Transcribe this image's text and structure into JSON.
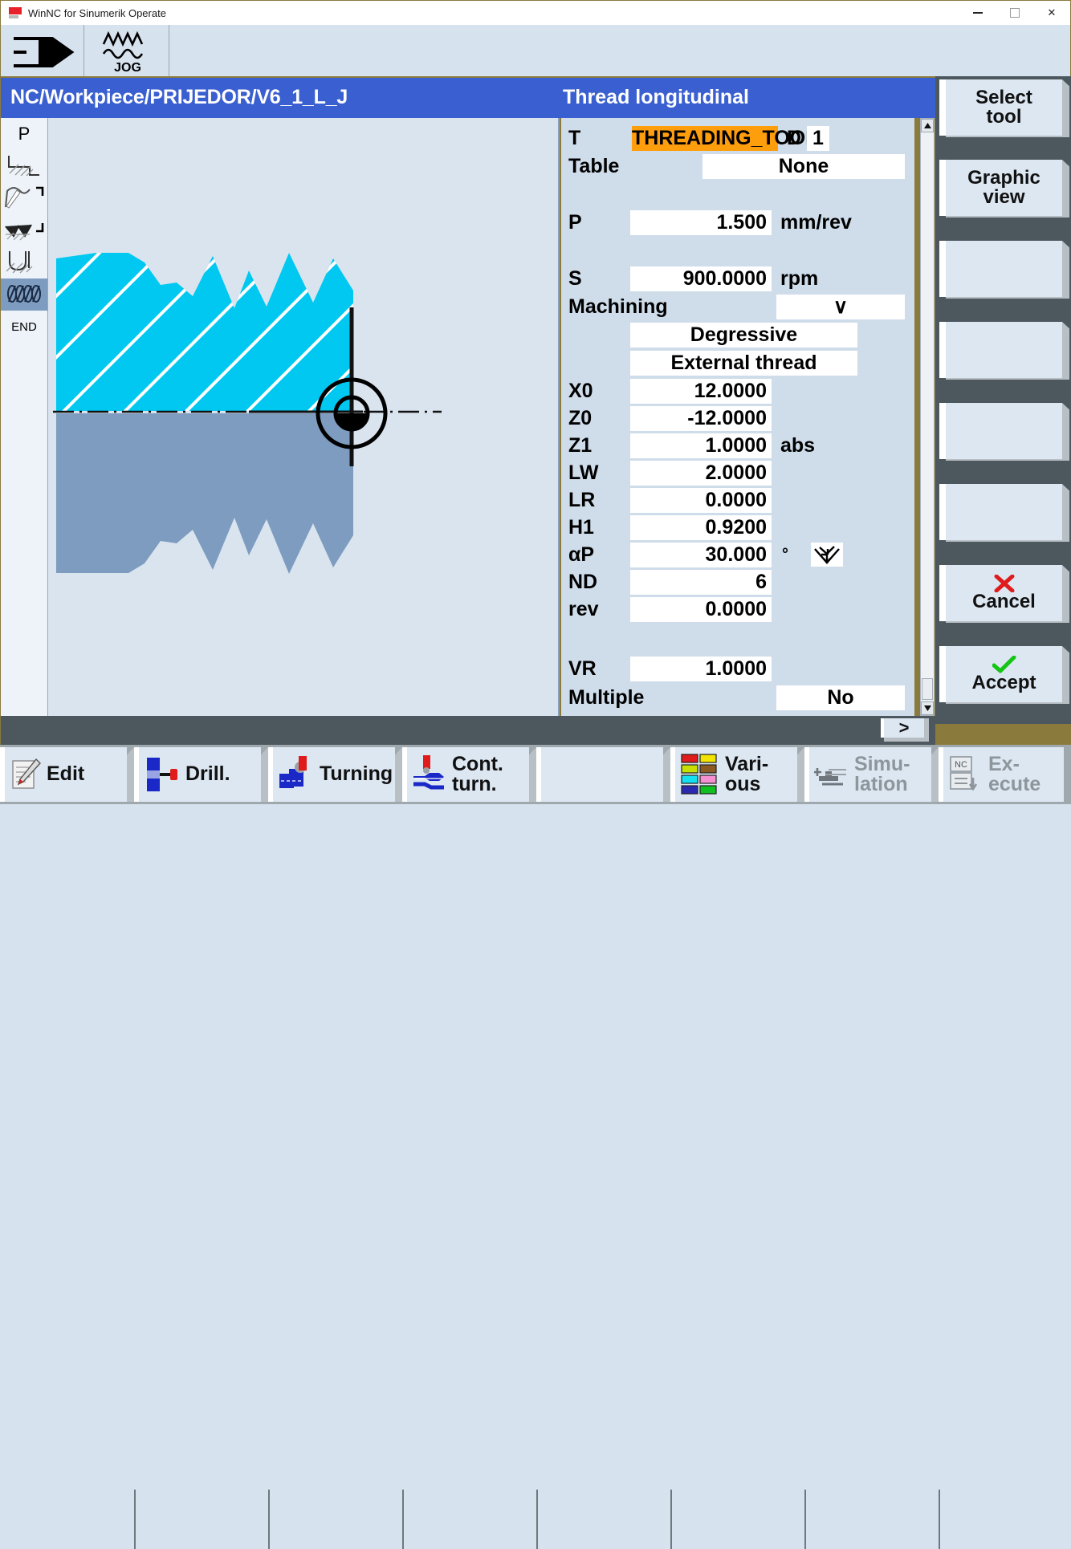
{
  "window": {
    "title": "WinNC for Sinumerik Operate",
    "controls": {
      "minimize": "minimize-icon",
      "maximize": "maximize-icon",
      "close": "close-icon"
    }
  },
  "toolbar": {
    "mode_icon": "machine-arrow-icon",
    "jog_label": "JOG",
    "jog_icon": "jog-wave-icon"
  },
  "header": {
    "path": "NC/Workpiece/PRIJEDOR/V6_1_L_J",
    "dialog_title": "Thread longitudinal",
    "accent": "#3a5fd0"
  },
  "steps": {
    "top_label": "P",
    "end_label": "END",
    "items": [
      {
        "name": "blank-stock-icon",
        "selected": false
      },
      {
        "name": "contour-turning-icon",
        "selected": false
      },
      {
        "name": "groove-icon",
        "selected": false
      },
      {
        "name": "undercut-icon",
        "selected": false
      },
      {
        "name": "thread-icon",
        "selected": true
      }
    ]
  },
  "graphic": {
    "name": "thread-longitudinal-help-graphic",
    "thread_color": "#00c8f0",
    "body_color": "#7e9cc0",
    "background": "#d9e4ef"
  },
  "form": {
    "tool": {
      "label": "T",
      "value": "THREADING_TOOL",
      "highlight": "#ff9e0d",
      "d_label": "D",
      "d_value": "1"
    },
    "table": {
      "label": "Table",
      "value": "None"
    },
    "pitch": {
      "label": "P",
      "value": "1.500",
      "unit": "mm/rev"
    },
    "spindle": {
      "label": "S",
      "value": "900.0000",
      "unit": "rpm"
    },
    "machining": {
      "label": "Machining",
      "value": "∨"
    },
    "infeed_mode": {
      "value": "Degressive"
    },
    "thread_type": {
      "value": "External thread"
    },
    "rows": [
      {
        "label": "X0",
        "value": "12.0000",
        "unit": ""
      },
      {
        "label": "Z0",
        "value": "-12.0000",
        "unit": ""
      },
      {
        "label": "Z1",
        "value": "1.0000",
        "unit": "abs"
      },
      {
        "label": "LW",
        "value": "2.0000",
        "unit": ""
      },
      {
        "label": "LR",
        "value": "0.0000",
        "unit": ""
      },
      {
        "label": "H1",
        "value": "0.9200",
        "unit": ""
      },
      {
        "label": "αP",
        "value": "30.000",
        "unit": "°",
        "icon": "infeed-direction-icon"
      },
      {
        "label": "ND",
        "value": "6",
        "unit": ""
      },
      {
        "label": "rev",
        "value": "0.0000",
        "unit": ""
      }
    ],
    "vr": {
      "label": "VR",
      "value": "1.0000"
    },
    "multiple": {
      "label": "Multiple",
      "value": "No"
    },
    "scrollbar": {
      "up": "scroll-up-icon",
      "down": "scroll-down-icon"
    },
    "expand_button": ">"
  },
  "right_softkeys": [
    {
      "line1": "Select",
      "line2": "tool",
      "name": "select-tool",
      "enabled": true,
      "icon": ""
    },
    {
      "line1": "Graphic",
      "line2": "view",
      "name": "graphic-view",
      "enabled": true,
      "icon": ""
    },
    {
      "line1": "",
      "line2": "",
      "name": "empty-3",
      "enabled": true,
      "icon": ""
    },
    {
      "line1": "",
      "line2": "",
      "name": "empty-4",
      "enabled": true,
      "icon": ""
    },
    {
      "line1": "",
      "line2": "",
      "name": "empty-5",
      "enabled": true,
      "icon": ""
    },
    {
      "line1": "",
      "line2": "",
      "name": "empty-6",
      "enabled": true,
      "icon": ""
    },
    {
      "line1": "",
      "line2": "Cancel",
      "name": "cancel",
      "enabled": true,
      "icon": "red-x-icon"
    },
    {
      "line1": "",
      "line2": "Accept",
      "name": "accept",
      "enabled": true,
      "icon": "green-check-icon"
    }
  ],
  "bottom_softkeys": [
    {
      "line1": "Edit",
      "line2": "",
      "name": "edit",
      "icon": "edit-pencil-icon",
      "enabled": true
    },
    {
      "line1": "Drill.",
      "line2": "",
      "name": "drilling",
      "icon": "drill-icon",
      "enabled": true
    },
    {
      "line1": "Turning",
      "line2": "",
      "name": "turning",
      "icon": "turning-icon",
      "enabled": true
    },
    {
      "line1": "Cont.",
      "line2": "turn.",
      "name": "cont-turning",
      "icon": "cont-turn-icon",
      "enabled": true
    },
    {
      "line1": "",
      "line2": "",
      "name": "empty-5",
      "icon": "",
      "enabled": true
    },
    {
      "line1": "Vari-",
      "line2": "ous",
      "name": "various",
      "icon": "color-grid-icon",
      "enabled": true
    },
    {
      "line1": "Simu-",
      "line2": "lation",
      "name": "simulation",
      "icon": "simulation-icon",
      "enabled": false
    },
    {
      "line1": "Ex-",
      "line2": "ecute",
      "name": "execute",
      "icon": "nc-execute-icon",
      "enabled": false
    }
  ],
  "various_colors": [
    "#e01b1b",
    "#f2e300",
    "#c8e000",
    "#8a5a20",
    "#14e0f0",
    "#f58fd0",
    "#2a2ab0",
    "#10c020"
  ]
}
